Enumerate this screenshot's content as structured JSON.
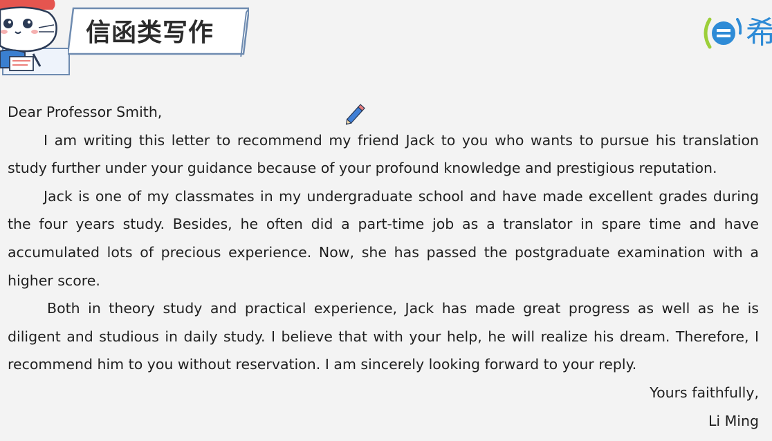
{
  "header": {
    "title": "信函类写作",
    "brand_text": "希"
  },
  "colors": {
    "background": "#f3f3f3",
    "banner_stroke": "#6e8bb0",
    "brand_blue": "#2e8bd6",
    "brand_green": "#9ccf3a"
  },
  "letter": {
    "salutation": "Dear Professor Smith,",
    "paragraphs": [
      "I am writing this letter to recommend my friend Jack to you who wants to pursue his translation study further under your guidance because of your profound knowledge and prestigious reputation.",
      "Jack is one of my classmates in my undergraduate school and have made excellent grades during the four years study. Besides, he often did a part-time job as a translator in spare time and have accumulated lots of precious experience. Now, she has passed the postgraduate examination with a higher score.",
      "Both in theory study and practical experience, Jack has made great progress as well as he is diligent and studious in daily study. I believe that with your help, he will realize his dream. Therefore, I recommend him to you without reservation. I am sincerely looking forward to your reply."
    ],
    "closing": "Yours faithfully,",
    "signature": "Li Ming"
  }
}
